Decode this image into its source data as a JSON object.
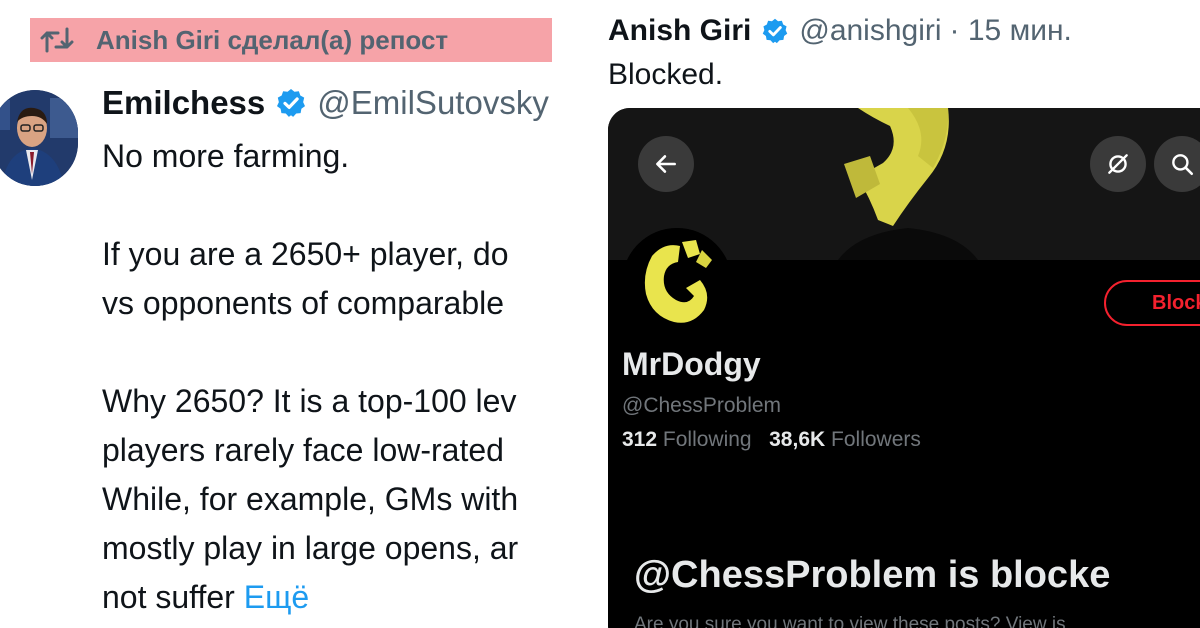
{
  "repost": {
    "text": "Anish Giri сделал(а) репост",
    "icon": "repost-icon",
    "highlight_color": "#f6a3a8"
  },
  "tweet": {
    "author_name": "Emilchess",
    "author_handle": "@EmilSutovsky",
    "verified_icon": "verified-badge-icon",
    "lines": [
      "No more farming.",
      "",
      "If you are a 2650+ player, do",
      "vs opponents of comparable",
      "",
      "Why 2650? It is a top-100 lev",
      "players rarely face low-rated",
      "While, for example, GMs with",
      "mostly play in large opens, ar",
      "not suffer"
    ],
    "more_label": "Ещё"
  },
  "giri_post": {
    "name": "Anish Giri",
    "handle": "@anishgiri",
    "time": "· 15 мин.",
    "text": "Blocked."
  },
  "profile_screenshot": {
    "back_icon": "back-arrow-icon",
    "nostr_icon": "no-sign-icon",
    "search_icon": "search-icon",
    "blocked_button_label": "Blocke",
    "name": "MrDodgy",
    "handle": "@ChessProblem",
    "following_count": "312",
    "following_label": "Following",
    "followers_count": "38,6K",
    "followers_label": "Followers",
    "blocked_headline": "@ChessProblem is blocke",
    "blocked_subtext": "Are you sure you want to view these posts? View is",
    "accent_color": "#f4212e"
  }
}
